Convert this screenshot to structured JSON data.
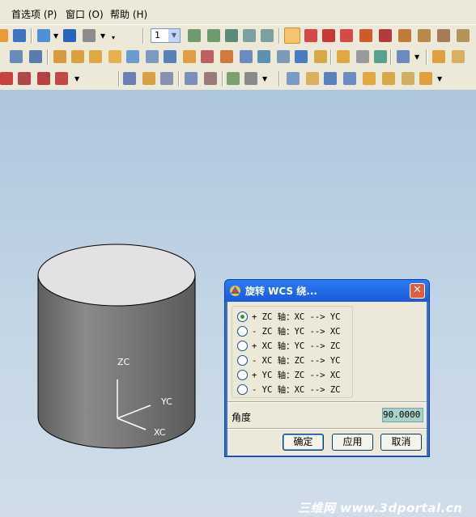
{
  "menu": {
    "items": [
      {
        "label": "首选项 (P)"
      },
      {
        "label": "窗口 (O)"
      },
      {
        "label": "帮助 (H)"
      }
    ]
  },
  "toolbar": {
    "layer_value": "1"
  },
  "viewport": {
    "axis_labels": {
      "zc": "ZC",
      "yc": "YC",
      "xc": "XC"
    },
    "colors": {
      "background": "#b8ccdf",
      "cylinder": "#8a8a8a",
      "cylinder_top": "#e2e2e2"
    }
  },
  "dialog": {
    "title": "旋转 WCS 绕...",
    "options": [
      {
        "label": "+ ZC 轴：XC --> YC",
        "selected": true
      },
      {
        "label": "- ZC 轴：YC --> XC",
        "selected": false
      },
      {
        "label": "+ XC 轴：YC --> ZC",
        "selected": false
      },
      {
        "label": "- XC 轴：ZC --> YC",
        "selected": false
      },
      {
        "label": "+ YC 轴：ZC --> XC",
        "selected": false
      },
      {
        "label": "- YC 轴：XC --> ZC",
        "selected": false
      }
    ],
    "angle_label": "角度",
    "angle_value": "90.0000",
    "buttons": {
      "ok": "确定",
      "apply": "应用",
      "cancel": "取消"
    }
  },
  "watermark": "三维网 www.3dportal.cn"
}
